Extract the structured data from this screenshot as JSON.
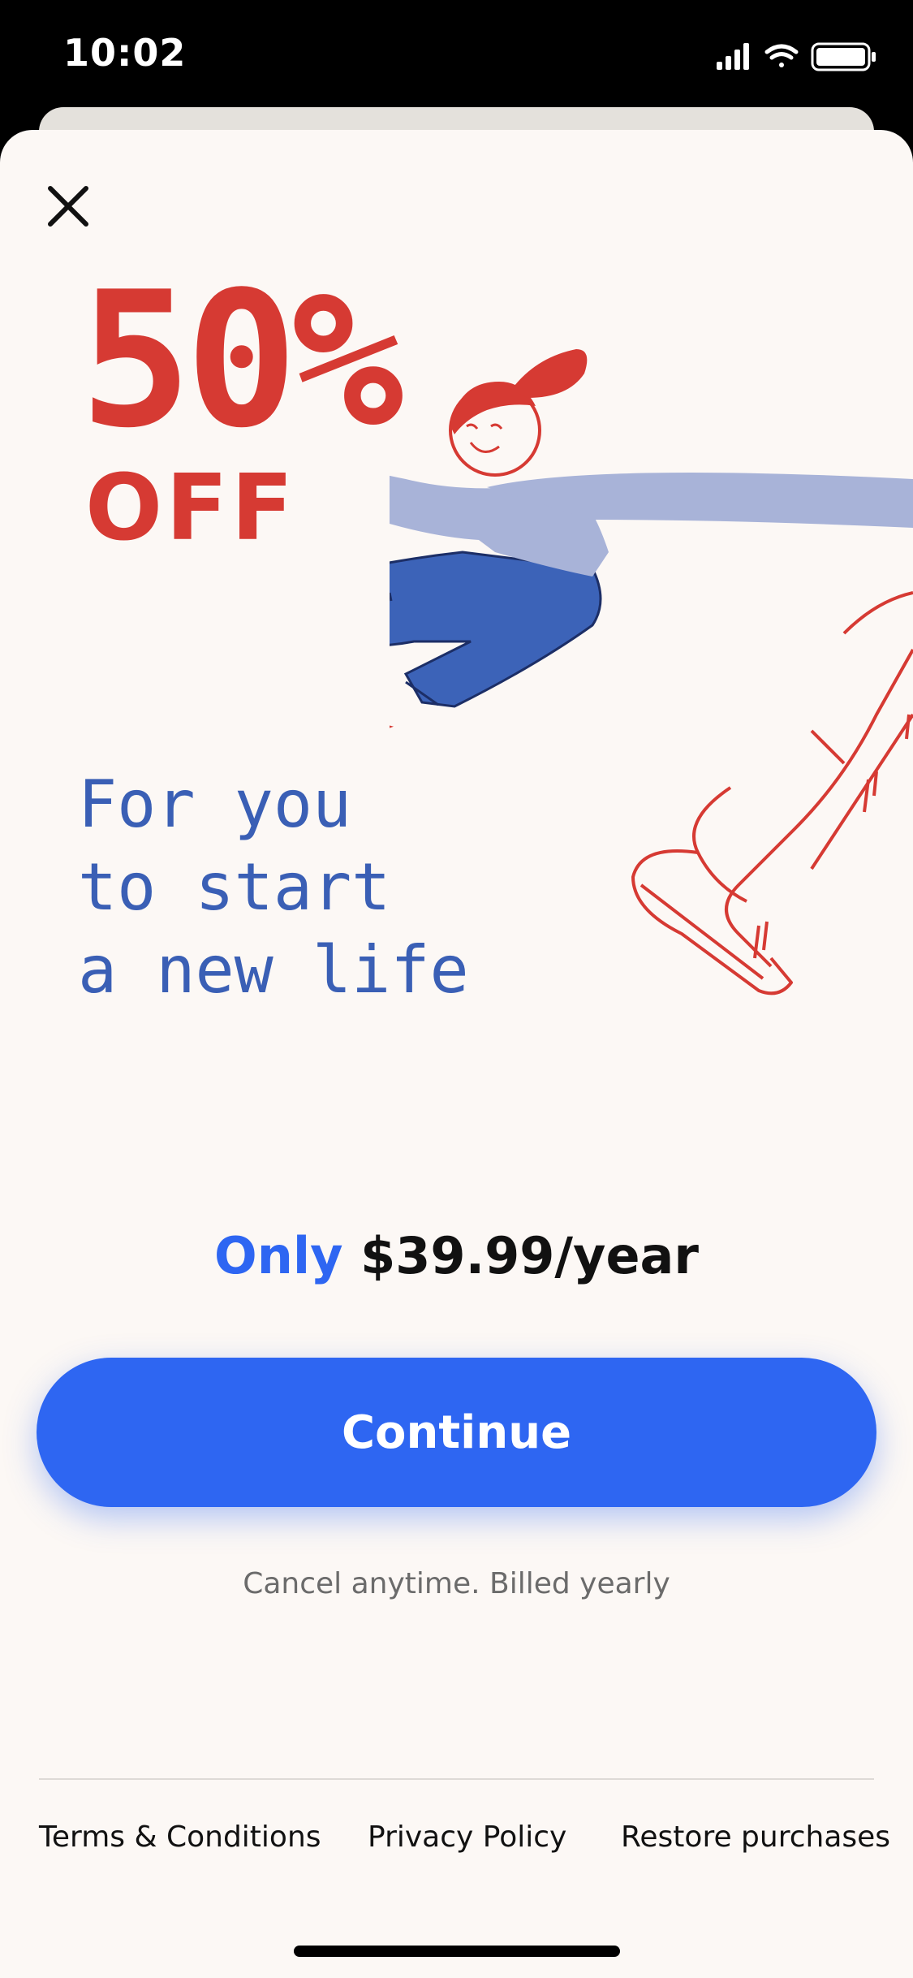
{
  "status_bar": {
    "time": "10:02"
  },
  "paywall": {
    "discount": "50%",
    "off_label": "OFF",
    "tagline": [
      "For you",
      "to start",
      "a new life"
    ],
    "price_prefix": "Only",
    "price": "$39.99/year",
    "cta_label": "Continue",
    "billing_note": "Cancel anytime. Billed yearly"
  },
  "footer": {
    "terms": "Terms & Conditions",
    "privacy": "Privacy Policy",
    "restore": "Restore purchases"
  },
  "colors": {
    "accent_red": "#d63a33",
    "tagline_blue": "#3a5fb5",
    "button_blue": "#2e66f2",
    "background": "#fcf8f5"
  },
  "icons": [
    "signal-icon",
    "wifi-icon",
    "battery-icon",
    "close-icon"
  ]
}
